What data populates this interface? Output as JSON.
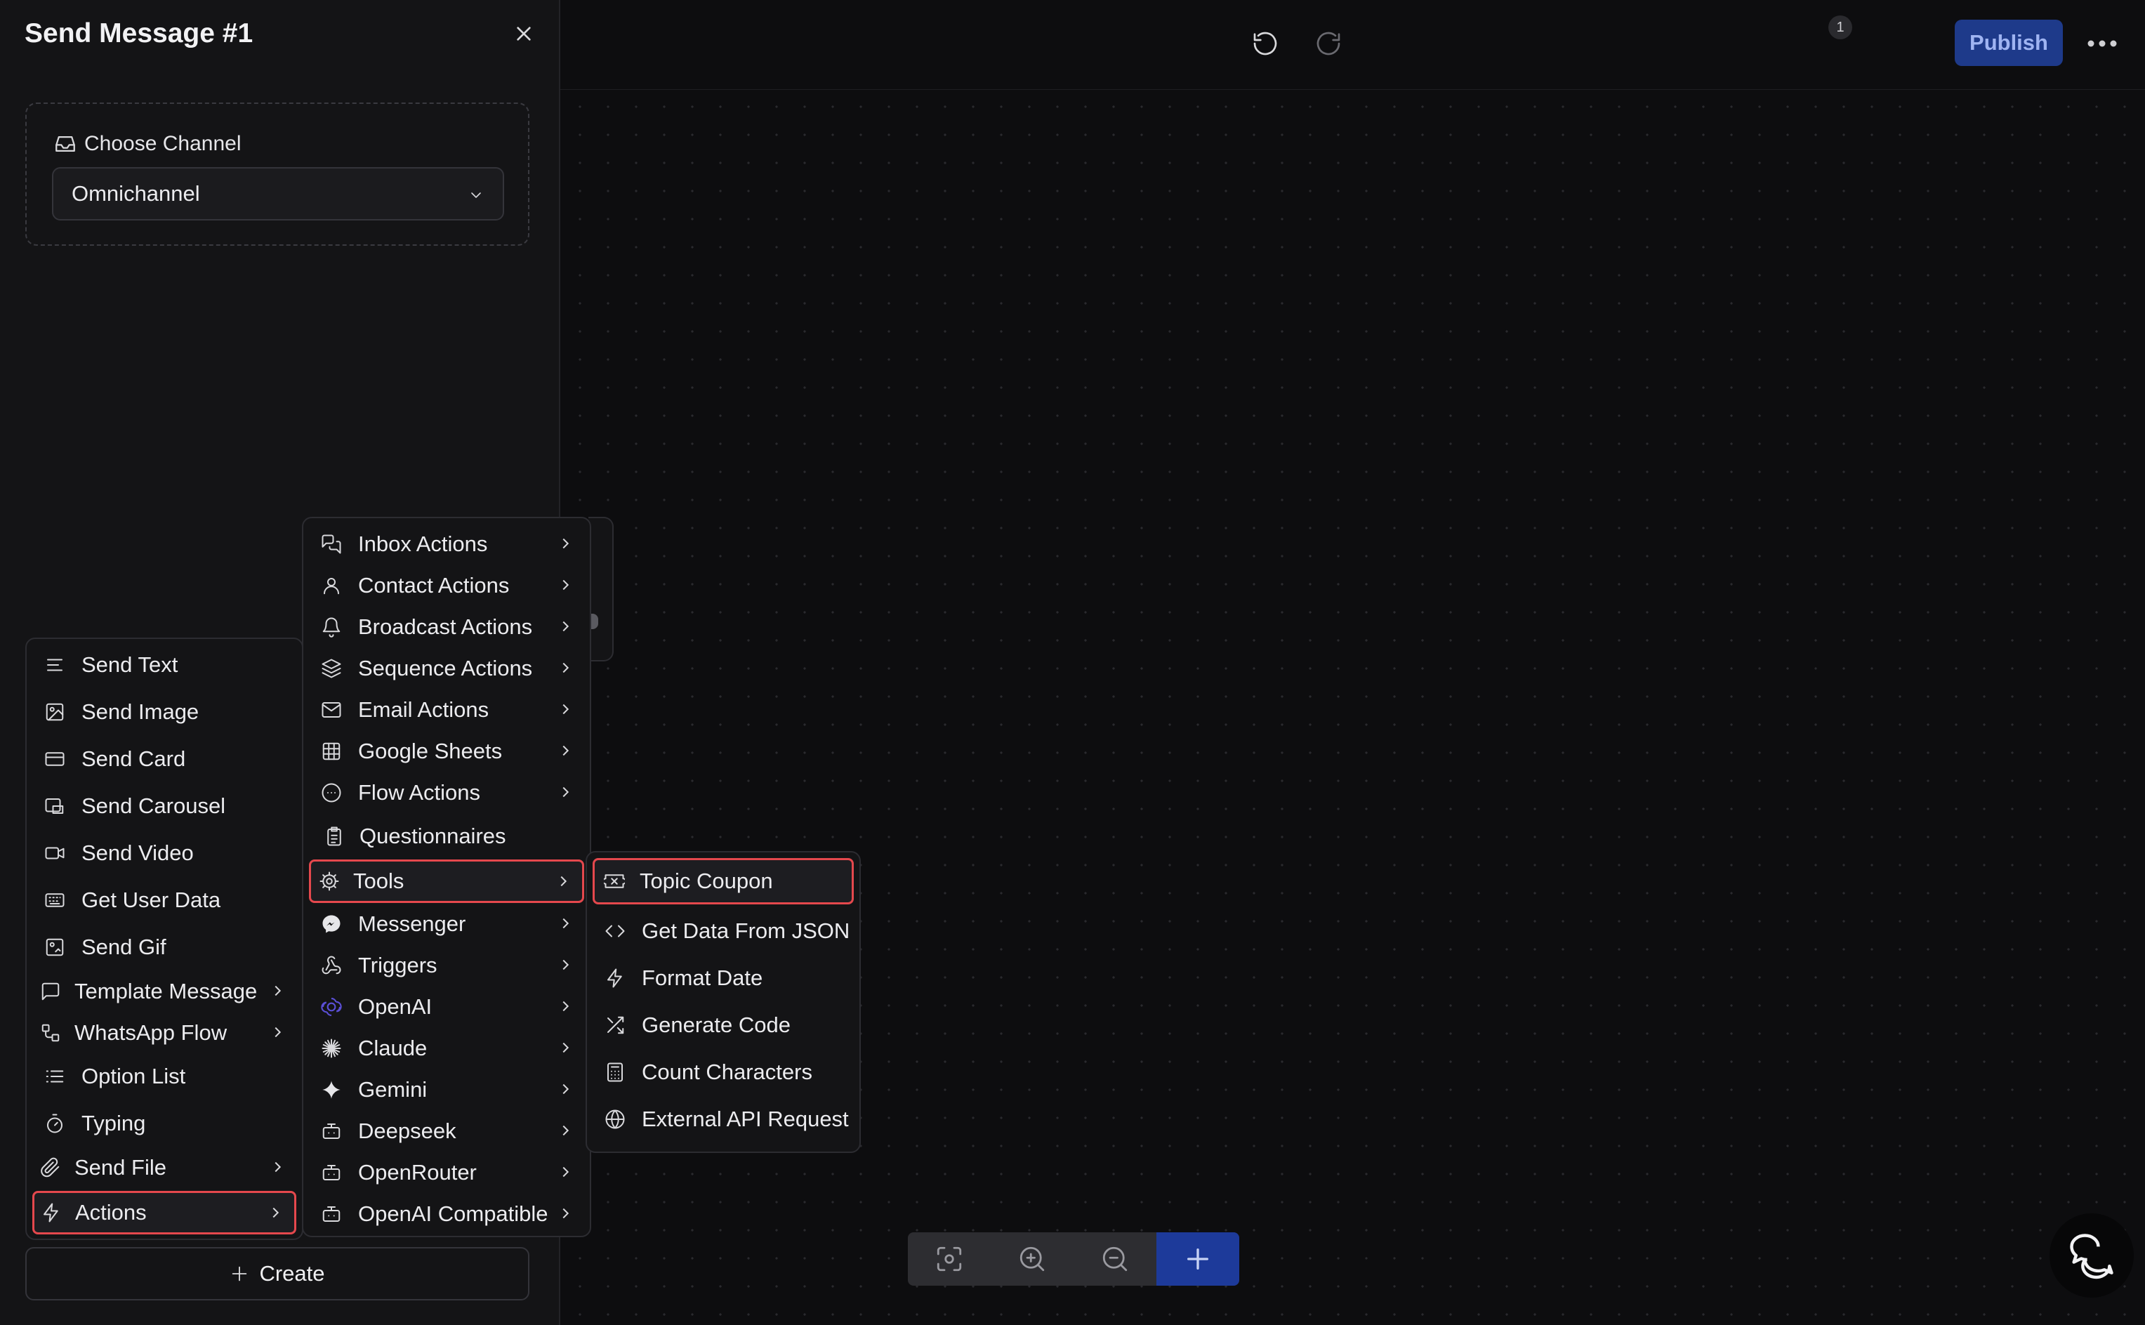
{
  "panel": {
    "title": "Send Message #1",
    "channel_label": "Choose Channel",
    "channel_value": "Omnichannel",
    "create_label": "Create"
  },
  "topbar": {
    "undo_count": "1",
    "publish_label": "Publish"
  },
  "menu1": {
    "items": [
      {
        "label": "Send Text",
        "icon": "text-lines-icon"
      },
      {
        "label": "Send Image",
        "icon": "image-icon"
      },
      {
        "label": "Send Card",
        "icon": "card-icon"
      },
      {
        "label": "Send Carousel",
        "icon": "carousel-icon"
      },
      {
        "label": "Send Video",
        "icon": "video-icon"
      },
      {
        "label": "Get User Data",
        "icon": "keyboard-icon"
      },
      {
        "label": "Send Gif",
        "icon": "gif-icon"
      },
      {
        "label": "Template Message",
        "icon": "message-square-icon"
      },
      {
        "label": "WhatsApp Flow",
        "icon": "flow-icon"
      },
      {
        "label": "Option List",
        "icon": "list-icon"
      },
      {
        "label": "Typing",
        "icon": "timer-icon"
      },
      {
        "label": "Send File",
        "icon": "paperclip-icon"
      },
      {
        "label": "Actions",
        "icon": "lightning-icon"
      }
    ]
  },
  "menu2": {
    "items": [
      {
        "label": "Inbox Actions",
        "icon": "messages-icon"
      },
      {
        "label": "Contact Actions",
        "icon": "user-icon"
      },
      {
        "label": "Broadcast Actions",
        "icon": "bell-icon"
      },
      {
        "label": "Sequence Actions",
        "icon": "layers-icon"
      },
      {
        "label": "Email Actions",
        "icon": "mail-icon"
      },
      {
        "label": "Google Sheets",
        "icon": "sheet-icon"
      },
      {
        "label": "Flow Actions",
        "icon": "dots-circle-icon"
      },
      {
        "label": "Questionnaires",
        "icon": "clipboard-icon"
      },
      {
        "label": "Tools",
        "icon": "gear-icon"
      },
      {
        "label": "Messenger",
        "icon": "messenger-icon"
      },
      {
        "label": "Triggers",
        "icon": "webhook-icon"
      },
      {
        "label": "OpenAI",
        "icon": "openai-icon"
      },
      {
        "label": "Claude",
        "icon": "claude-icon"
      },
      {
        "label": "Gemini",
        "icon": "gemini-icon"
      },
      {
        "label": "Deepseek",
        "icon": "bot-icon"
      },
      {
        "label": "OpenRouter",
        "icon": "bot-icon"
      },
      {
        "label": "OpenAI Compatible",
        "icon": "bot-icon"
      }
    ]
  },
  "menu3": {
    "items": [
      {
        "label": "Topic Coupon",
        "icon": "ticket-icon"
      },
      {
        "label": "Get Data From JSON",
        "icon": "code-icon"
      },
      {
        "label": "Format Date",
        "icon": "lightning-icon"
      },
      {
        "label": "Generate Code",
        "icon": "shuffle-icon"
      },
      {
        "label": "Count Characters",
        "icon": "calculator-icon"
      },
      {
        "label": "External API Request",
        "icon": "globe-icon"
      }
    ]
  },
  "colors": {
    "highlight": "#e5484d",
    "publish_bg": "#1e3a8a",
    "add_bg": "#1d3a9a",
    "openai_icon": "#5b4fd6"
  }
}
